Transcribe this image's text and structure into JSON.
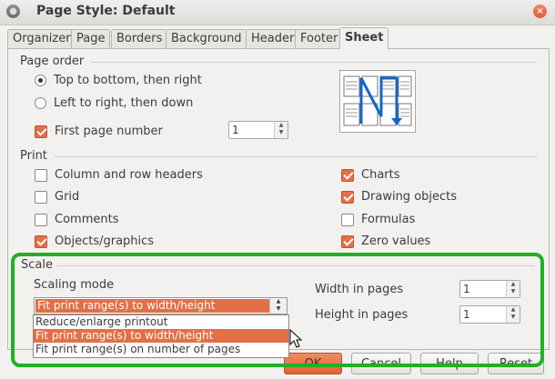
{
  "window": {
    "title": "Page Style: Default"
  },
  "tabs": [
    {
      "label": "Organizer"
    },
    {
      "label": "Page"
    },
    {
      "label": "Borders"
    },
    {
      "label": "Background"
    },
    {
      "label": "Header"
    },
    {
      "label": "Footer"
    },
    {
      "label": "Sheet",
      "active": true
    }
  ],
  "page_order": {
    "label": "Page order",
    "options": [
      {
        "label": "Top to bottom, then right",
        "selected": true
      },
      {
        "label": "Left to right, then down",
        "selected": false
      }
    ],
    "first_page_number": {
      "label": "First page number",
      "checked": true,
      "value": "1"
    }
  },
  "print": {
    "label": "Print",
    "left": [
      {
        "label": "Column and row headers",
        "checked": false
      },
      {
        "label": "Grid",
        "checked": false
      },
      {
        "label": "Comments",
        "checked": false
      },
      {
        "label": "Objects/graphics",
        "checked": true
      }
    ],
    "right": [
      {
        "label": "Charts",
        "checked": true
      },
      {
        "label": "Drawing objects",
        "checked": true
      },
      {
        "label": "Formulas",
        "checked": false
      },
      {
        "label": "Zero values",
        "checked": true
      }
    ]
  },
  "scale": {
    "label": "Scale",
    "scaling_mode_label": "Scaling mode",
    "selected_mode": "Fit print range(s) to width/height",
    "options": [
      {
        "label": "Reduce/enlarge printout",
        "highlighted": false
      },
      {
        "label": "Fit print range(s) to width/height",
        "highlighted": true
      },
      {
        "label": "Fit print range(s) on number of pages",
        "highlighted": false
      }
    ],
    "width_in_pages": {
      "label": "Width in pages",
      "value": "1"
    },
    "height_in_pages": {
      "label": "Height in pages",
      "value": "1"
    }
  },
  "buttons": {
    "ok": "OK",
    "cancel": "Cancel",
    "help": "Help",
    "reset": "Reset"
  },
  "colors": {
    "accent": "#e36f46",
    "annotation_box": "#22b022"
  }
}
